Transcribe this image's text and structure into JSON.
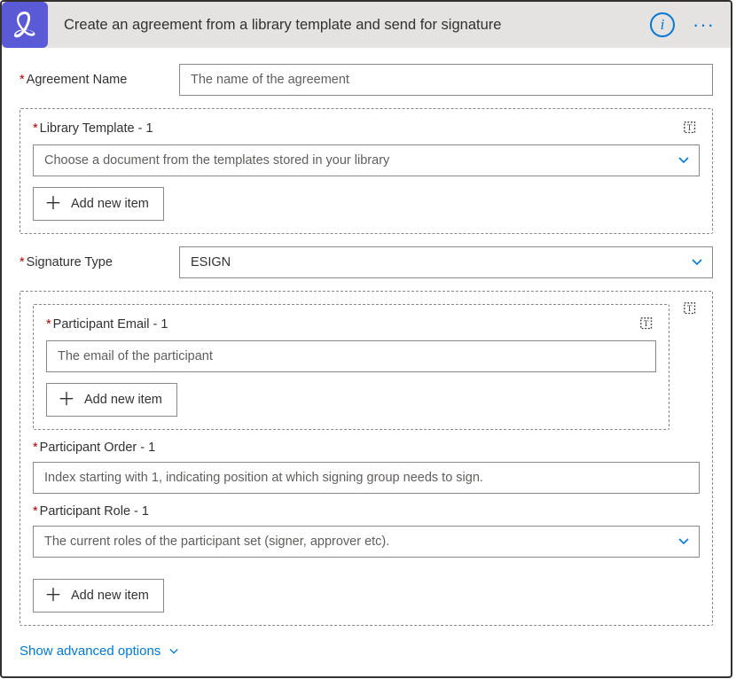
{
  "header": {
    "title": "Create an agreement from a library template and send for signature"
  },
  "fields": {
    "agreement_name": {
      "label": "Agreement Name",
      "placeholder": "The name of the agreement"
    },
    "library_template": {
      "label": "Library Template - 1",
      "placeholder": "Choose a document from the templates stored in your library",
      "add_label": "Add new item"
    },
    "signature_type": {
      "label": "Signature Type",
      "value": "ESIGN"
    },
    "participant": {
      "email": {
        "label": "Participant Email - 1",
        "placeholder": "The email of the participant",
        "add_label": "Add new item"
      },
      "order": {
        "label": "Participant Order - 1",
        "placeholder": "Index starting with 1, indicating position at which signing group needs to sign."
      },
      "role": {
        "label": "Participant Role - 1",
        "placeholder": "The current roles of the participant set (signer, approver etc)."
      },
      "add_label": "Add new item"
    }
  },
  "footer": {
    "advanced_label": "Show advanced options"
  },
  "colors": {
    "accent": "#0078d4",
    "app_icon_bg": "#5a5ad6",
    "required": "#a80000"
  }
}
